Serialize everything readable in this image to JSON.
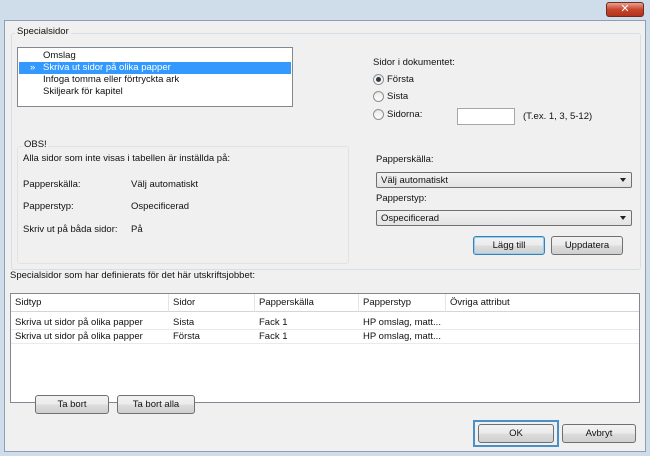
{
  "window": {
    "close_glyph": "✕"
  },
  "special_pages": {
    "legend": "Specialsidor",
    "list": [
      {
        "marker": "",
        "label": "Omslag",
        "selected": false
      },
      {
        "marker": "»",
        "label": "Skriva ut sidor på olika papper",
        "selected": true
      },
      {
        "marker": "",
        "label": "Infoga tomma eller förtryckta ark",
        "selected": false
      },
      {
        "marker": "",
        "label": "Skiljeark för kapitel",
        "selected": false
      }
    ],
    "pages_in_document_label": "Sidor i dokumentet:",
    "radio_first": "Första",
    "radio_last": "Sista",
    "radio_pages": "Sidorna:",
    "pages_value": "",
    "pages_hint": "(T.ex. 1, 3, 5-12)",
    "selected_radio": "Första"
  },
  "notice": {
    "title": "OBS!",
    "text": "Alla sidor som inte visas i tabellen är inställda på:",
    "rows": [
      {
        "label": "Papperskälla:",
        "value": "Välj automatiskt"
      },
      {
        "label": "Papperstyp:",
        "value": "Ospecificerad"
      },
      {
        "label": "Skriv ut på båda sidor:",
        "value": "På"
      }
    ]
  },
  "settings": {
    "paper_source_label": "Papperskälla:",
    "paper_source_value": "Välj automatiskt",
    "paper_type_label": "Papperstyp:",
    "paper_type_value": "Ospecificerad",
    "add_button": "Lägg till",
    "update_button": "Uppdatera"
  },
  "defined_pages": {
    "caption": "Specialsidor som har definierats för det här utskriftsjobbet:",
    "columns": [
      "Sidtyp",
      "Sidor",
      "Papperskälla",
      "Papperstyp",
      "Övriga attribut"
    ],
    "rows": [
      [
        "Skriva ut sidor på olika papper",
        "Sista",
        "Fack 1",
        "HP omslag, matt...",
        ""
      ],
      [
        "Skriva ut sidor på olika papper",
        "Första",
        "Fack 1",
        "HP omslag, matt...",
        ""
      ]
    ],
    "remove_button": "Ta bort",
    "remove_all_button": "Ta bort alla"
  },
  "footer": {
    "ok_button": "OK",
    "cancel_button": "Avbryt"
  }
}
